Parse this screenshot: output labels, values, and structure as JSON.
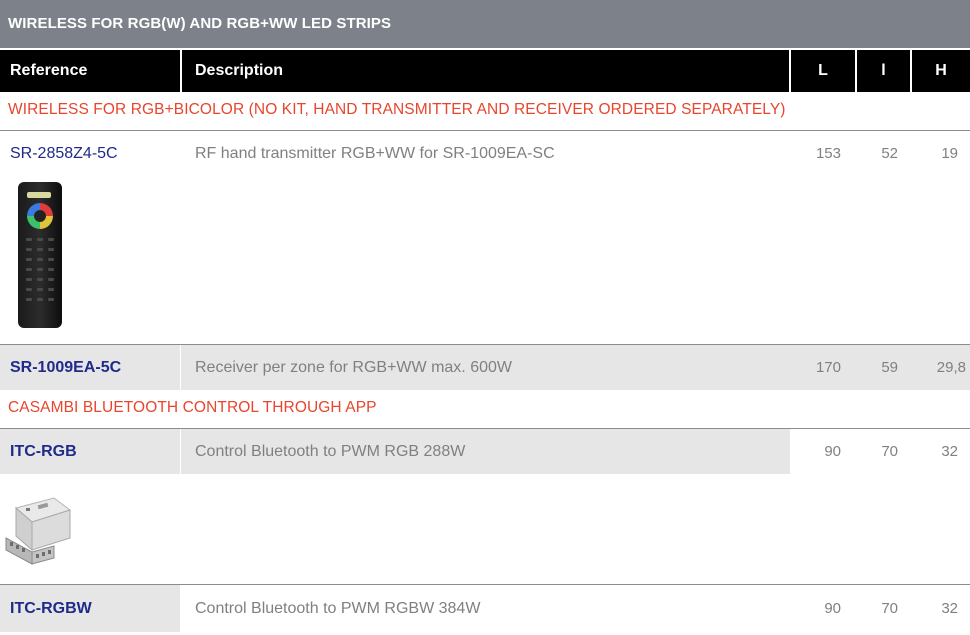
{
  "title": "WIRELESS FOR RGB(W) AND RGB+WW LED STRIPS",
  "columns": {
    "reference": "Reference",
    "description": "Description",
    "L": "L",
    "l": "l",
    "H": "H"
  },
  "sections": [
    {
      "heading": "WIRELESS FOR RGB+BICOLOR (NO KIT, HAND TRANSMITTER AND RECEIVER ORDERED SEPARATELY)",
      "rows": [
        {
          "reference": "SR-2858Z4-5C",
          "description": "RF hand transmitter RGB+WW for SR-1009EA-SC",
          "L": "153",
          "l": "52",
          "H": "19"
        },
        {
          "reference": "SR-1009EA-5C",
          "description": "Receiver per zone for RGB+WW max. 600W",
          "L": "170",
          "l": "59",
          "H": "29,8"
        }
      ]
    },
    {
      "heading": "CASAMBI BLUETOOTH CONTROL THROUGH APP",
      "rows": [
        {
          "reference": "ITC-RGB",
          "description": "Control Bluetooth to PWM RGB 288W",
          "L": "90",
          "l": "70",
          "H": "32"
        },
        {
          "reference": "ITC-RGBW",
          "description": "Control Bluetooth to PWM RGBW 384W",
          "L": "90",
          "l": "70",
          "H": "32"
        }
      ]
    }
  ],
  "images": [
    {
      "name": "rf-hand-transmitter-image",
      "depicts": "black remote control with colour wheel"
    },
    {
      "name": "bluetooth-controller-image",
      "depicts": "grey controller box with terminal blocks"
    }
  ],
  "colors": {
    "title_bg": "#7d8189",
    "header_bg": "#000000",
    "section_text": "#e8452c",
    "reference_text": "#1f2a8a",
    "row_shade": "#e6e6e6"
  }
}
